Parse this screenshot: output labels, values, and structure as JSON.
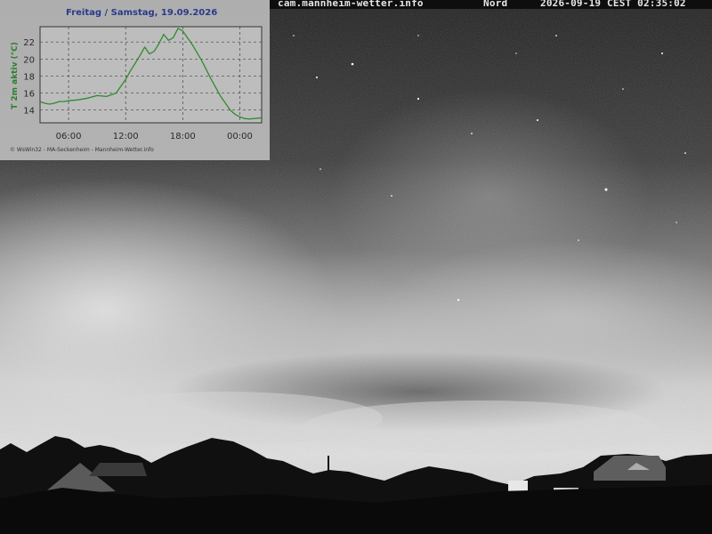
{
  "overlay": {
    "site": "cam.mannheim-wetter.info",
    "direction": "Nord",
    "timestamp": "2026-09-19 CEST 02:35:02"
  },
  "panel": {
    "title": "Freitag / Samstag, 19.09.2026",
    "credit": "© WsWin32 - MA-Seckenheim - Mannheim-Wetter.info"
  },
  "chart_data": {
    "type": "line",
    "title": "Freitag / Samstag, 19.09.2026",
    "xlabel": "",
    "ylabel": "T 2m aktiv (°C)",
    "x_ticks": [
      "06:00",
      "12:00",
      "18:00",
      "00:00"
    ],
    "x_tick_hours": [
      6,
      12,
      18,
      24
    ],
    "xlim": [
      3,
      26.3
    ],
    "y_ticks": [
      14,
      16,
      18,
      20,
      22
    ],
    "ylim": [
      12.5,
      23.8
    ],
    "grid": true,
    "series": [
      {
        "color": "#2e8b2e",
        "x": [
          3.0,
          3.5,
          4.0,
          4.5,
          5.0,
          5.5,
          6.0,
          7.0,
          8.0,
          9.0,
          10.0,
          11.0,
          11.5,
          12.0,
          12.5,
          13.0,
          13.5,
          14.0,
          14.5,
          15.0,
          15.5,
          16.0,
          16.5,
          17.0,
          17.5,
          18.0,
          19.0,
          20.0,
          21.0,
          22.0,
          23.0,
          23.5,
          24.0,
          24.5,
          25.0,
          25.5,
          26.3
        ],
        "y": [
          15.0,
          14.8,
          14.7,
          14.8,
          15.0,
          15.0,
          15.1,
          15.2,
          15.4,
          15.7,
          15.6,
          16.0,
          16.8,
          17.6,
          18.6,
          19.5,
          20.4,
          21.4,
          20.6,
          20.9,
          21.8,
          22.9,
          22.2,
          22.5,
          23.6,
          23.3,
          21.7,
          19.8,
          17.6,
          15.6,
          14.0,
          13.5,
          13.2,
          13.0,
          12.95,
          13.0,
          13.1
        ]
      }
    ]
  }
}
